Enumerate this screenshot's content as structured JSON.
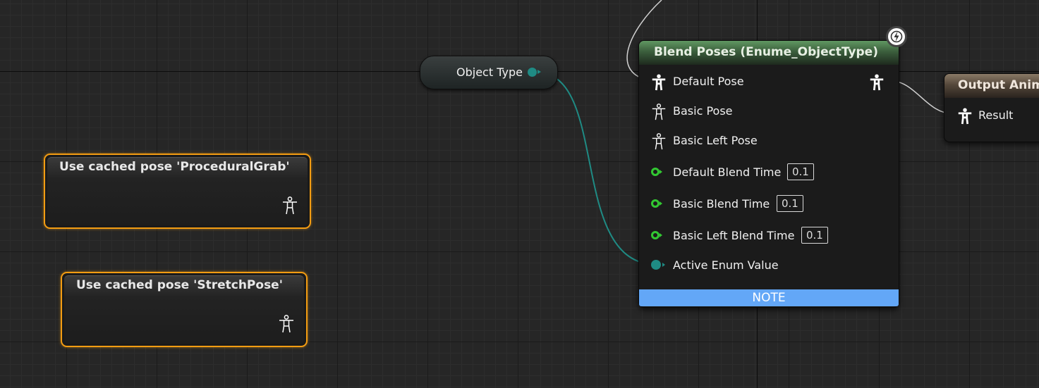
{
  "graph": {
    "cached_nodes": [
      {
        "title": "Use cached pose 'ProceduralGrab'"
      },
      {
        "title": "Use cached pose 'StretchPose'"
      }
    ],
    "object_type_node": {
      "label": "Object Type"
    },
    "blend_node": {
      "title": "Blend Poses (Enume_ObjectType)",
      "pins": {
        "default_pose": "Default Pose",
        "basic_pose": "Basic Pose",
        "basic_left_pose": "Basic Left Pose",
        "default_blend_time": {
          "label": "Default Blend Time",
          "value": "0.1"
        },
        "basic_blend_time": {
          "label": "Basic Blend Time",
          "value": "0.1"
        },
        "basic_left_blend_time": {
          "label": "Basic Left Blend Time",
          "value": "0.1"
        },
        "active_enum_value": "Active Enum Value"
      },
      "note": "NOTE",
      "header_color": "#4f7f50",
      "note_color": "#63a7f7"
    },
    "output_node": {
      "title": "Output Anima",
      "pin": "Result",
      "header_color": "#6e6152"
    },
    "colors": {
      "selection": "#f39c12",
      "enum_wire": "#1f8b84",
      "float_pin": "#32c832",
      "exec_wire": "#cfcfcf"
    }
  }
}
